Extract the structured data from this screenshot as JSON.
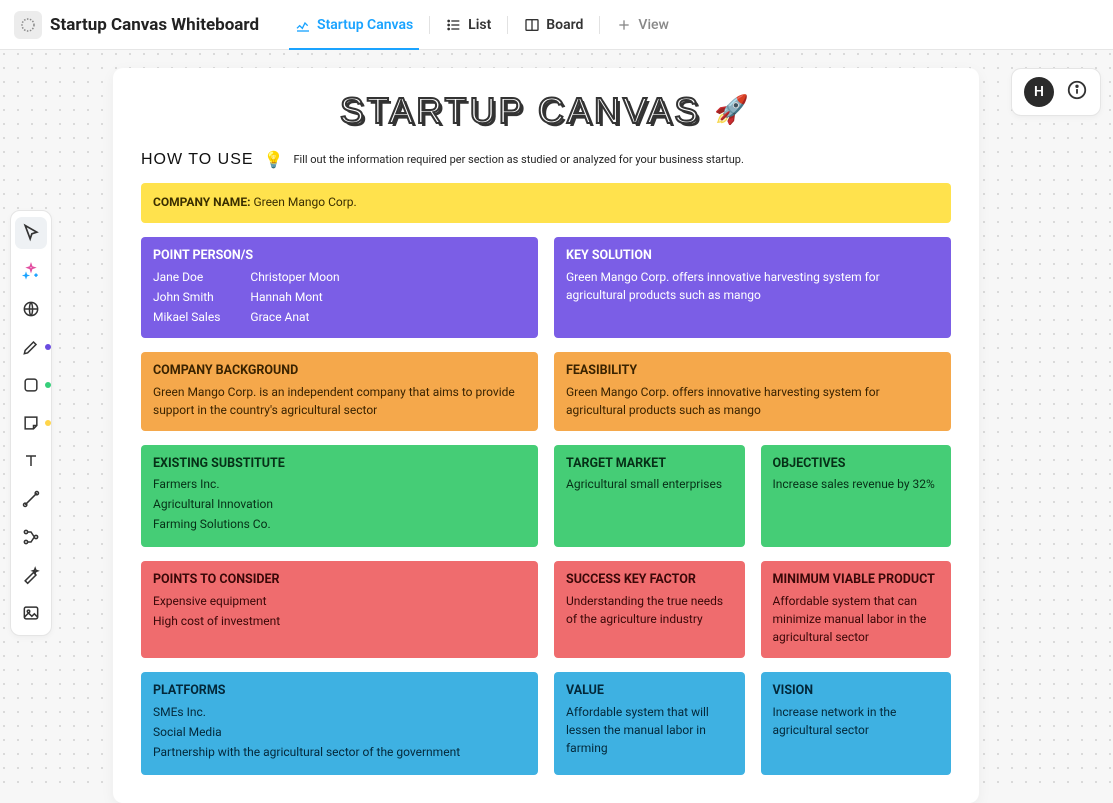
{
  "header": {
    "doc_title": "Startup Canvas Whiteboard",
    "tabs": {
      "canvas": "Startup Canvas",
      "list": "List",
      "board": "Board",
      "addview": "View"
    }
  },
  "user": {
    "initial": "H"
  },
  "canvas": {
    "title": "STARTUP CANVAS",
    "howto_label": "HOW TO USE",
    "howto_text": "Fill out the information required per section as studied or analyzed for your business startup.",
    "company_name_label": "COMPANY NAME:",
    "company_name": "Green Mango Corp.",
    "point_persons": {
      "title": "POINT PERSON/S",
      "col1": [
        "Jane Doe",
        "John Smith",
        "Mikael Sales"
      ],
      "col2": [
        "Christoper Moon",
        "Hannah Mont",
        "Grace Anat"
      ]
    },
    "key_solution": {
      "title": "KEY SOLUTION",
      "text": "Green Mango Corp. offers innovative harvesting system for agricultural products such as mango"
    },
    "background": {
      "title": "COMPANY BACKGROUND",
      "text": "Green Mango Corp. is an independent company that aims to provide support in the country's agricultural sector"
    },
    "feasibility": {
      "title": "FEASIBILITY",
      "text": "Green Mango Corp. offers innovative harvesting system for agricultural products such as mango"
    },
    "existing_substitute": {
      "title": "EXISTING SUBSTITUTE",
      "items": [
        "Farmers Inc.",
        "Agricultural Innovation",
        "Farming Solutions Co."
      ]
    },
    "target_market": {
      "title": "TARGET MARKET",
      "text": "Agricultural small enterprises"
    },
    "objectives": {
      "title": "OBJECTIVES",
      "text": "Increase sales revenue by 32%"
    },
    "points_to_consider": {
      "title": "POINTS TO CONSIDER",
      "items": [
        "Expensive equipment",
        "High cost of investment"
      ]
    },
    "success_key_factor": {
      "title": "SUCCESS KEY FACTOR",
      "text": "Understanding the true needs of the agriculture industry"
    },
    "mvp": {
      "title": "MINIMUM VIABLE PRODUCT",
      "text": "Affordable system that can minimize manual labor in the agricultural sector"
    },
    "platforms": {
      "title": "PLATFORMS",
      "items": [
        "SMEs Inc.",
        "Social Media",
        "Partnership with the agricultural sector of the government"
      ]
    },
    "value": {
      "title": "VALUE",
      "text": "Affordable system that will lessen the manual labor in farming"
    },
    "vision": {
      "title": "VISION",
      "text": "Increase network in the agricultural sector"
    }
  }
}
